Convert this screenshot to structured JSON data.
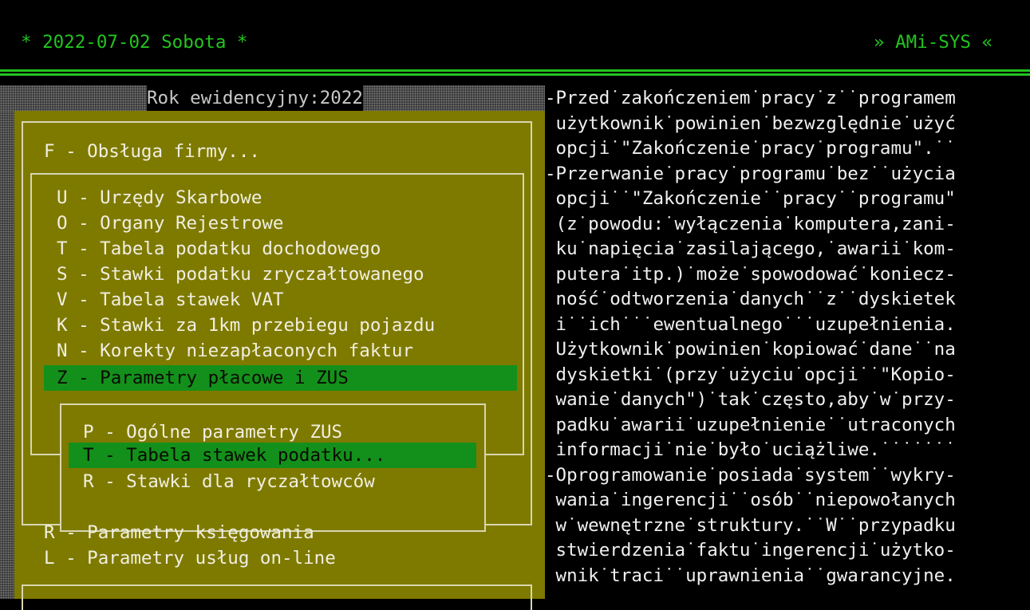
{
  "header": {
    "date": "* 2022-07-02 Sobota *",
    "app": "» AMi-SYS «"
  },
  "year_label": "Rok ewidencyjny:2022",
  "main_menu": {
    "title_item": "F - Obsługa firmy...",
    "items": [
      {
        "label": "U - Urzędy Skarbowe",
        "selected": false
      },
      {
        "label": "O - Organy Rejestrowe",
        "selected": false
      },
      {
        "label": "T - Tabela podatku dochodowego",
        "selected": false
      },
      {
        "label": "S - Stawki podatku zryczałtowanego",
        "selected": false
      },
      {
        "label": "V - Tabela stawek VAT",
        "selected": false
      },
      {
        "label": "K - Stawki za 1km przebiegu pojazdu",
        "selected": false
      },
      {
        "label": "N - Korekty niezapłaconych faktur",
        "selected": false
      },
      {
        "label": "Z - Parametry płacowe i ZUS",
        "selected": true
      }
    ]
  },
  "submenu": {
    "items": [
      {
        "label": "P - Ogólne parametry ZUS",
        "selected": false
      },
      {
        "label": "T - Tabela stawek podatku...",
        "selected": true
      },
      {
        "label": "R - Stawki dla ryczałtowców",
        "selected": false
      }
    ]
  },
  "bottom_items": [
    "R - Parametry księgowania",
    "L - Parametry usług on-line"
  ],
  "help_text": [
    "-Przed˙zakończeniem˙pracy˙z˙˙programem",
    " użytkownik˙powinien˙bezwzględnie˙użyć",
    " opcji˙\"Zakończenie˙pracy˙programu\".˙˙",
    "-Przerwanie˙pracy˙programu˙bez˙˙użycia",
    " opcji˙˙\"Zakończenie˙˙pracy˙˙programu\"",
    " (z˙powodu:˙wyłączenia˙komputera,zani-",
    " ku˙napięcia˙zasilającego,˙awarii˙kom-",
    " putera˙itp.)˙może˙spowodować˙koniecz-",
    " ność˙odtworzenia˙danych˙˙z˙˙dyskietek",
    " i˙˙ich˙˙˙ewentualnego˙˙˙uzupełnienia.",
    " Użytkownik˙powinien˙kopiować˙dane˙˙na",
    " dyskietki˙(przy˙użyciu˙opcji˙˙\"Kopio-",
    " wanie˙danych\")˙tak˙często,aby˙w˙przy-",
    " padku˙awarii˙uzupełnienie˙˙utraconych",
    " informacji˙nie˙było˙uciążliwe.˙˙˙˙˙˙˙",
    "-Oprogramowanie˙posiada˙system˙˙wykry-",
    " wania˙ingerencji˙˙osób˙˙niepowołanych",
    " w˙wewnętrzne˙struktury.˙˙W˙˙przypadku",
    " stwierdzenia˙faktu˙ingerencji˙użytko-",
    " wnik˙traci˙˙uprawnienia˙˙gwarancyjne."
  ],
  "colors": {
    "background": "#000000",
    "header_text": "#22c41e",
    "panel": "#7e7a00",
    "selection": "#13901b",
    "help_text": "#f0f0f0"
  }
}
